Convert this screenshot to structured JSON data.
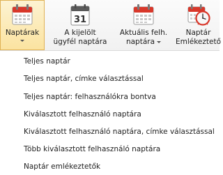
{
  "ribbon": {
    "buttons": [
      {
        "label": "Naptárak",
        "label_lines": [
          "Naptárak"
        ],
        "has_caret": true,
        "active": true,
        "icon": "calendar-icon"
      },
      {
        "label": "A kijelölt ügyfél naptára",
        "label_lines": [
          "A kijelölt",
          "ügyfél naptára"
        ],
        "has_caret": false,
        "active": false,
        "icon": "calendar-31-icon",
        "icon_text": "31"
      },
      {
        "label": "Aktuális felh. naptára",
        "label_lines": [
          "Aktuális felh.",
          "naptára"
        ],
        "has_caret": true,
        "active": false,
        "icon": "calendar-icon"
      },
      {
        "label": "Naptár Emlékeztető",
        "label_lines": [
          "Naptár",
          "Emlékeztető"
        ],
        "has_caret": false,
        "active": false,
        "icon": "calendar-alarm-clock-icon"
      }
    ]
  },
  "menu": {
    "items": [
      "Teljes naptár",
      "Teljes naptár, címke választással",
      "Teljes naptár: felhasználókra bontva",
      "Kiválasztott felhasználó naptára",
      "Kiválasztott felhasználó naptára, címke választással",
      "Több kiválasztott felhasználó naptára",
      "Naptár emlékeztetők"
    ]
  },
  "colors": {
    "calendar_red": "#d8382b",
    "active_highlight": "#fbe3a0",
    "active_border": "#e0b255"
  }
}
